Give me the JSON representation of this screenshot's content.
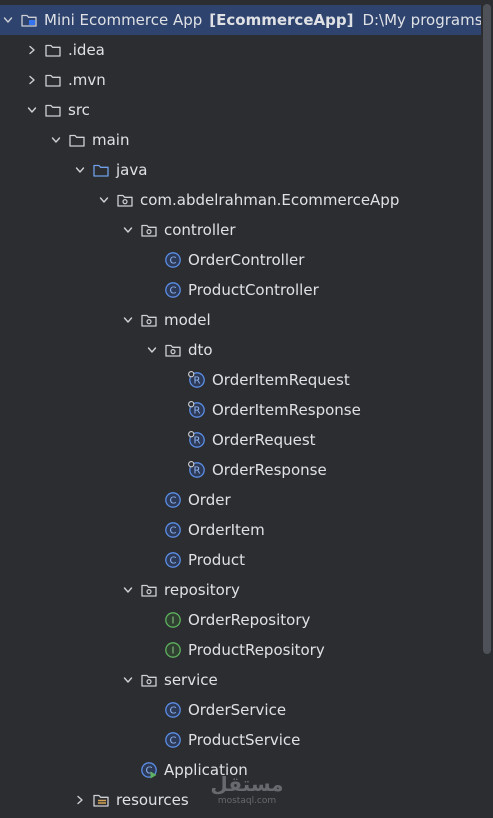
{
  "project": {
    "name": "Mini Ecommerce App",
    "module": "[EcommerceApp]",
    "path": "D:\\My programs"
  },
  "tree": [
    {
      "label": "Mini Ecommerce App",
      "kind": "project",
      "icon": "module-folder-icon",
      "chevron": "expanded",
      "depth": 0
    },
    {
      "label": ".idea",
      "kind": "folder",
      "icon": "folder-icon",
      "chevron": "collapsed",
      "depth": 1
    },
    {
      "label": ".mvn",
      "kind": "folder",
      "icon": "folder-icon",
      "chevron": "collapsed",
      "depth": 1
    },
    {
      "label": "src",
      "kind": "folder",
      "icon": "folder-icon",
      "chevron": "expanded",
      "depth": 1
    },
    {
      "label": "main",
      "kind": "folder",
      "icon": "folder-icon",
      "chevron": "expanded",
      "depth": 2
    },
    {
      "label": "java",
      "kind": "source-root",
      "icon": "source-folder-icon",
      "chevron": "expanded",
      "depth": 3
    },
    {
      "label": "com.abdelrahman.EcommerceApp",
      "kind": "package",
      "icon": "package-icon",
      "chevron": "expanded",
      "depth": 4
    },
    {
      "label": "controller",
      "kind": "package",
      "icon": "package-icon",
      "chevron": "expanded",
      "depth": 5
    },
    {
      "label": "OrderController",
      "kind": "class",
      "icon": "class-icon",
      "chevron": "none",
      "depth": 6
    },
    {
      "label": "ProductController",
      "kind": "class",
      "icon": "class-icon",
      "chevron": "none",
      "depth": 6
    },
    {
      "label": "model",
      "kind": "package",
      "icon": "package-icon",
      "chevron": "expanded",
      "depth": 5
    },
    {
      "label": "dto",
      "kind": "package",
      "icon": "package-icon",
      "chevron": "expanded",
      "depth": 6
    },
    {
      "label": "OrderItemRequest",
      "kind": "record",
      "icon": "record-icon",
      "chevron": "none",
      "depth": 7
    },
    {
      "label": "OrderItemResponse",
      "kind": "record",
      "icon": "record-icon",
      "chevron": "none",
      "depth": 7
    },
    {
      "label": "OrderRequest",
      "kind": "record",
      "icon": "record-icon",
      "chevron": "none",
      "depth": 7
    },
    {
      "label": "OrderResponse",
      "kind": "record",
      "icon": "record-icon",
      "chevron": "none",
      "depth": 7
    },
    {
      "label": "Order",
      "kind": "class",
      "icon": "class-icon",
      "chevron": "none",
      "depth": 6
    },
    {
      "label": "OrderItem",
      "kind": "class",
      "icon": "class-icon",
      "chevron": "none",
      "depth": 6
    },
    {
      "label": "Product",
      "kind": "class",
      "icon": "class-icon",
      "chevron": "none",
      "depth": 6
    },
    {
      "label": "repository",
      "kind": "package",
      "icon": "package-icon",
      "chevron": "expanded",
      "depth": 5
    },
    {
      "label": "OrderRepository",
      "kind": "interface",
      "icon": "interface-icon",
      "chevron": "none",
      "depth": 6
    },
    {
      "label": "ProductRepository",
      "kind": "interface",
      "icon": "interface-icon",
      "chevron": "none",
      "depth": 6
    },
    {
      "label": "service",
      "kind": "package",
      "icon": "package-icon",
      "chevron": "expanded",
      "depth": 5
    },
    {
      "label": "OrderService",
      "kind": "class",
      "icon": "class-icon",
      "chevron": "none",
      "depth": 6
    },
    {
      "label": "ProductService",
      "kind": "class",
      "icon": "class-icon",
      "chevron": "none",
      "depth": 6
    },
    {
      "label": "Application",
      "kind": "app-class",
      "icon": "application-class-icon",
      "chevron": "none",
      "depth": 5
    },
    {
      "label": "resources",
      "kind": "resources",
      "icon": "resources-folder-icon",
      "chevron": "collapsed",
      "depth": 3
    }
  ],
  "watermark": {
    "text": "مستقل",
    "sub": "mostaql.com"
  },
  "colors": {
    "background": "#2b2d30",
    "selection": "#2e436e",
    "text": "#dfe1e5",
    "class_icon": "#5b8ee6",
    "interface_icon": "#5fb25f",
    "source_folder": "#6fa0e8",
    "folder_outline": "#ced0d6"
  }
}
